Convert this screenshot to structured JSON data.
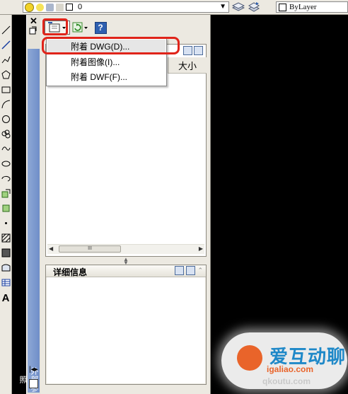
{
  "toolbar": {
    "layer_value": "0",
    "linetype_value": "ByLayer"
  },
  "palette": {
    "side_title": "外部参照",
    "toolbar": {
      "attach_icon": "attach-dwg-icon",
      "refresh_icon": "refresh-icon",
      "help_label": "?"
    },
    "list": {
      "size_column_header": "大小",
      "scrollbar_grip": "III"
    },
    "details": {
      "title": "详细信息"
    }
  },
  "attach_menu": {
    "items": [
      {
        "label": "附着 DWG(D)..."
      },
      {
        "label": "附着图像(I)..."
      },
      {
        "label": "附着 DWF(F)..."
      }
    ]
  },
  "watermark": {
    "brand": "爱互动聊",
    "url": "igaliao.com",
    "url2": "qkoutu.com"
  },
  "colors": {
    "highlight": "#e0241a",
    "model_space": "#000000",
    "palette_title_blue": "#7d9bd0"
  }
}
